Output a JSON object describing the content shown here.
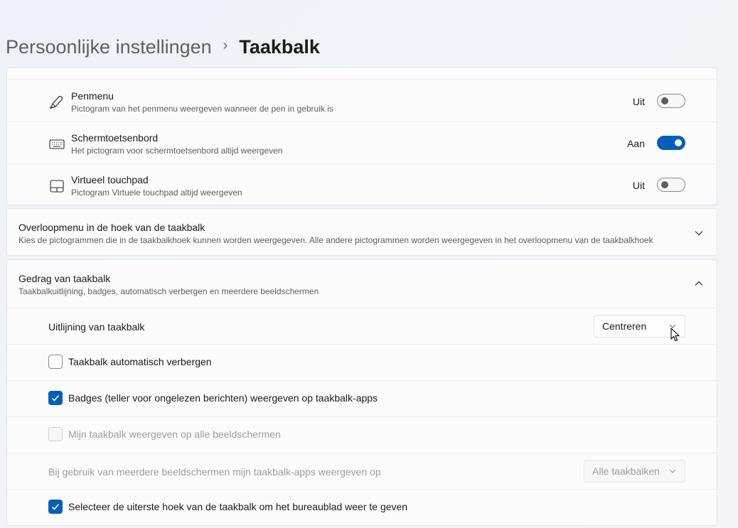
{
  "breadcrumb": {
    "parent": "Persoonlijke instellingen",
    "separator": "›",
    "current": "Taakbalk"
  },
  "pen_items": [
    {
      "icon": "pen-icon",
      "title": "Penmenu",
      "subtitle": "Pictogram van het penmenu weergeven wanneer de pen in gebruik is",
      "state": "Uit",
      "on": false
    },
    {
      "icon": "keyboard-icon",
      "title": "Schermtoetsenbord",
      "subtitle": "Het pictogram voor schermtoetsenbord altijd weergeven",
      "state": "Aan",
      "on": true
    },
    {
      "icon": "touchpad-icon",
      "title": "Virtueel touchpad",
      "subtitle": "Pictogram Virtuele touchpad altijd weergeven",
      "state": "Uit",
      "on": false
    }
  ],
  "overflow": {
    "title": "Overloopmenu in de hoek van de taakbalk",
    "subtitle": "Kies de pictogrammen die in de taakbalkhoek kunnen worden weergegeven. Alle andere pictogrammen worden weergegeven in het overloopmenu van de taakbalkhoek",
    "expanded": false
  },
  "behavior": {
    "title": "Gedrag van taakbalk",
    "subtitle": "Taakbalkuitlijning, badges, automatisch verbergen en meerdere beeldschermen",
    "expanded": true,
    "alignment_label": "Uitlijning van taakbalk",
    "alignment_value": "Centreren",
    "autohide_label": "Taakbalk automatisch verbergen",
    "autohide_checked": false,
    "badges_label": "Badges (teller voor ongelezen berichten) weergeven op taakbalk-apps",
    "badges_checked": true,
    "all_displays_label": "Mijn taakbalk weergeven op alle beeldschermen",
    "all_displays_checked": false,
    "multi_label": "Bij gebruik van meerdere beeldschermen mijn taakbalk-apps weergeven op",
    "multi_value": "Alle taakbalken",
    "corner_label": "Selecteer de uiterste hoek van de taakbalk om het bureaublad weer te geven",
    "corner_checked": true
  },
  "colors": {
    "accent": "#005fb8",
    "card": "#fbfbfb",
    "disabled_text": "#9d9d9d"
  }
}
